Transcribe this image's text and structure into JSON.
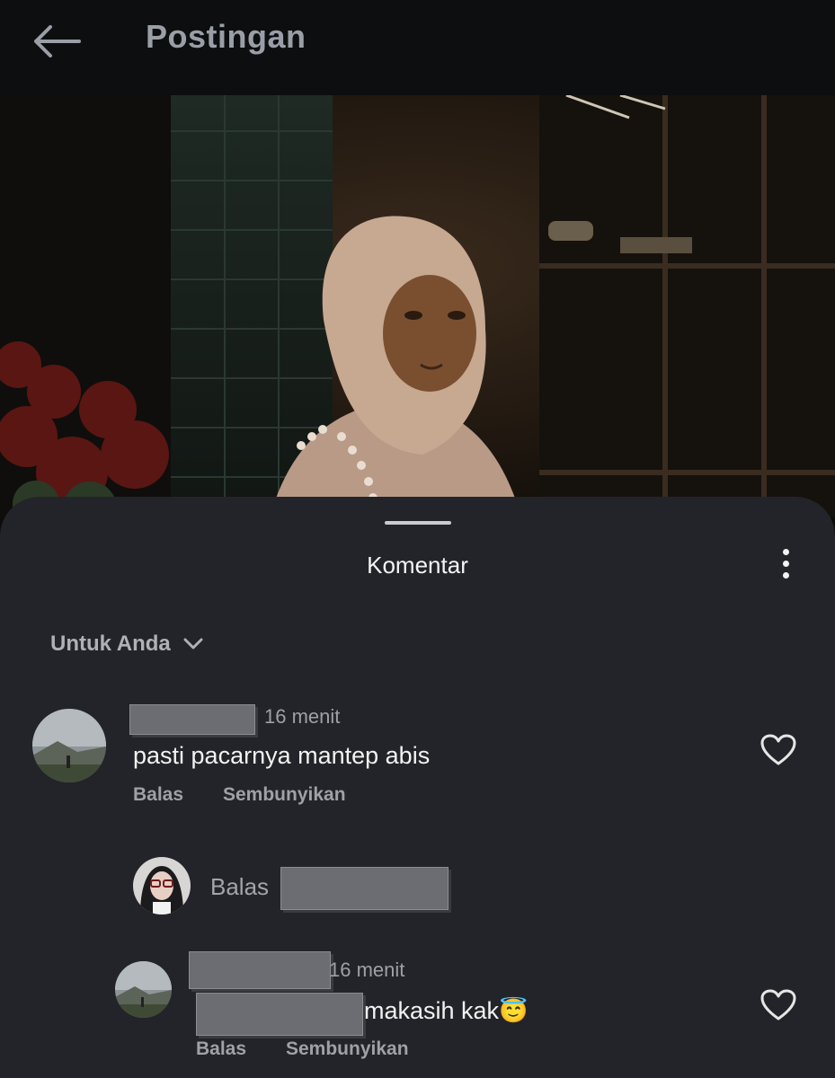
{
  "header": {
    "title": "Postingan",
    "back_icon": "arrow-left-icon"
  },
  "post": {
    "image_description_icon": "photo"
  },
  "comments_sheet": {
    "title": "Komentar",
    "more_icon": "more-vertical-icon",
    "filter_label": "Untuk Anda",
    "filter_icon": "chevron-down-icon"
  },
  "comments": [
    {
      "time": "16 menit",
      "text": "pasti pacarnya mantep abis",
      "reply_label": "Balas",
      "hide_label": "Sembunyikan",
      "like_icon": "heart-outline-icon"
    }
  ],
  "reply_box": {
    "label": "Balas"
  },
  "replies": [
    {
      "time": "16 menit",
      "text": "makasih kak",
      "emoji": "😇",
      "reply_label": "Balas",
      "hide_label": "Sembunyikan",
      "like_icon": "heart-outline-icon"
    }
  ],
  "colors": {
    "background": "#0b0c0e",
    "sheet": "#232429",
    "muted_text": "#9da0a7"
  }
}
